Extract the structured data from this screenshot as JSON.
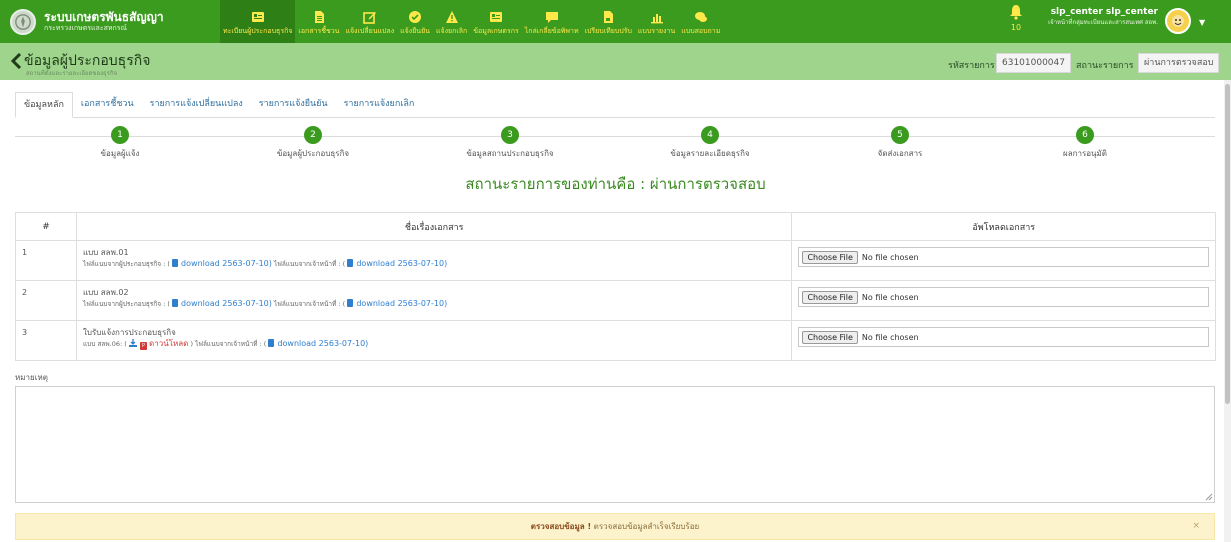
{
  "brand": {
    "title": "ระบบเกษตรพันธสัญญา",
    "subtitle": "กระทรวงเกษตรและสหกรณ์"
  },
  "nav": {
    "items": [
      {
        "label": "ทะเบียนผู้ประกอบธุรกิจ",
        "icon": "id-card-icon",
        "active": true
      },
      {
        "label": "เอกสารชี้ชวน",
        "icon": "document-icon",
        "active": false
      },
      {
        "label": "แจ้งเปลี่ยนแปลง",
        "icon": "edit-icon",
        "active": false
      },
      {
        "label": "แจ้งยืนยัน",
        "icon": "check-circle-icon",
        "active": false
      },
      {
        "label": "แจ้งยกเลิก",
        "icon": "warning-icon",
        "active": false
      },
      {
        "label": "ข้อมูลเกษตรกร",
        "icon": "id-card-icon",
        "active": false
      },
      {
        "label": "ไกล่เกลี่ยข้อพิพาท",
        "icon": "comment-icon",
        "active": false
      },
      {
        "label": "เปรียบเทียบปรับ",
        "icon": "file-icon",
        "active": false
      },
      {
        "label": "แบบรายงาน",
        "icon": "chart-icon",
        "active": false
      },
      {
        "label": "แบบสอบถาม",
        "icon": "chat-icon",
        "active": false
      }
    ]
  },
  "notifications": {
    "count": "10"
  },
  "user": {
    "name": "slp_center slp_center",
    "role": "เจ้าหน้าที่กลุ่มทะเบียนและสารสนเทศ สอพ."
  },
  "header": {
    "title": "ข้อมูลผู้ประกอบธุรกิจ",
    "subtitle": "สถานที่ตั้งและรายละเอียดของธุรกิจ",
    "code_label": "รหัสรายการ",
    "code_value": "63101000047",
    "status_label": "สถานะรายการ",
    "status_value": "ผ่านการตรวจสอบ"
  },
  "tabs": [
    "ข้อมูลหลัก",
    "เอกสารชี้ชวน",
    "รายการแจ้งเปลี่ยนแปลง",
    "รายการแจ้งยืนยัน",
    "รายการแจ้งยกเลิก"
  ],
  "steps": [
    {
      "num": "1",
      "label": "ข้อมูลผู้แจ้ง"
    },
    {
      "num": "2",
      "label": "ข้อมูลผู้ประกอบธุรกิจ"
    },
    {
      "num": "3",
      "label": "ข้อมูลสถานประกอบธุรกิจ"
    },
    {
      "num": "4",
      "label": "ข้อมูลรายละเอียดธุรกิจ"
    },
    {
      "num": "5",
      "label": "จัดส่งเอกสาร"
    },
    {
      "num": "6",
      "label": "ผลการอนุมัติ"
    }
  ],
  "status_message": "สถานะรายการของท่านคือ : ผ่านการตรวจสอบ",
  "table": {
    "headers": [
      "#",
      "ชื่อเรื่องเอกสาร",
      "อัพโหลดเอกสาร"
    ],
    "rows": [
      {
        "num": "1",
        "title": "แบบ สลพ.01",
        "owner_label": "ไฟล์แนบจากผู้ประกอบธุรกิจ : (",
        "owner_link": "download 2563-07-10)",
        "officer_label": "ไฟล์แนบจากเจ้าหน้าที่ : (",
        "officer_link": "download 2563-07-10)"
      },
      {
        "num": "2",
        "title": "แบบ สลพ.02",
        "owner_label": "ไฟล์แนบจากผู้ประกอบธุรกิจ : (",
        "owner_link": "download 2563-07-10)",
        "officer_label": "ไฟล์แนบจากเจ้าหน้าที่ : (",
        "officer_link": "download 2563-07-10)"
      },
      {
        "num": "3",
        "title": "ใบรับแจ้งการประกอบธุรกิจ",
        "form_label": "แบบ สลพ.06: (",
        "form_link": "ดาวน์โหลด",
        "form_close": ")",
        "officer_label": "ไฟล์แนบจากเจ้าหน้าที่ : (",
        "officer_link": "download 2563-07-10)"
      }
    ],
    "choose_file": "Choose File",
    "no_file": "No file chosen"
  },
  "remark_label": "หมายเหตุ",
  "alert": {
    "strong": "ตรวจสอบข้อมูล !",
    "text": "ตรวจสอบข้อมูลสำเร็จเรียบร้อย",
    "close": "×"
  },
  "colors": {
    "navbar": "#3a9b1e",
    "subheader": "#9ed48c",
    "nav_text": "#ffe84a",
    "step": "#3a9b1e",
    "link": "#2f7fcf",
    "alert_bg": "#fcf3cd"
  }
}
